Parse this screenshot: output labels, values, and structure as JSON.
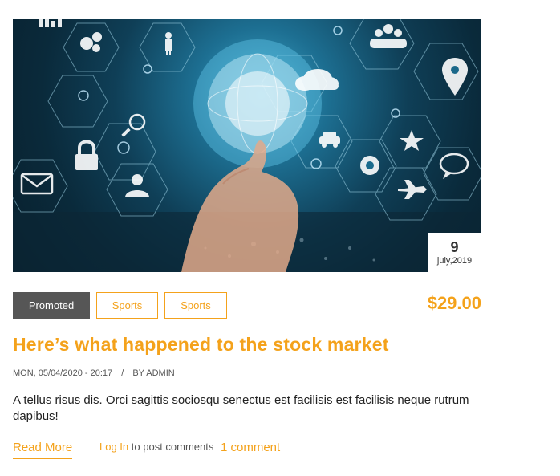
{
  "article": {
    "image": {
      "alt": "",
      "icons": [
        "bar-chart-icon",
        "gears-icon",
        "person-icon",
        "group-icon",
        "cloud-icon",
        "map-pin-icon",
        "search-icon",
        "lock-icon",
        "car-icon",
        "star-icon",
        "settings-icon",
        "mail-icon",
        "user-icon",
        "chat-icon",
        "plane-icon",
        "globe-icon"
      ]
    },
    "date": {
      "day": "9",
      "month_year": "july,2019"
    },
    "tags": [
      {
        "label": "Promoted"
      },
      {
        "label": "Sports"
      },
      {
        "label": "Sports"
      }
    ],
    "price": "$29.00",
    "title": "Here’s what happened to the stock market",
    "meta": {
      "date": "MON, 05/04/2020 - 20:17",
      "separator": "/",
      "author": "BY ADMIN"
    },
    "body": "A tellus risus dis. Orci sagittis sociosqu senectus est facilisis est facilisis neque rutrum dapibus!",
    "actions": {
      "read_more": "Read More",
      "login": "Log In",
      "login_suffix": "to post comments",
      "comments": "1 comment"
    }
  },
  "colors": {
    "accent": "#f4a21b",
    "promoted_bg": "#565656"
  }
}
